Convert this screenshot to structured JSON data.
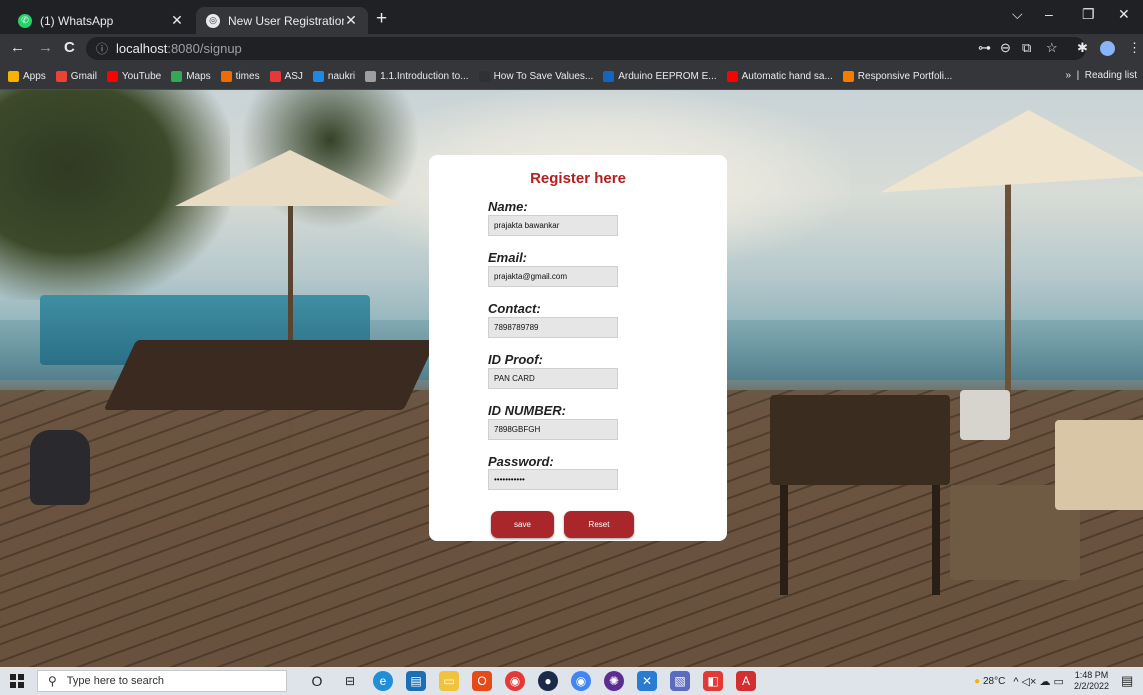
{
  "browser": {
    "tabs": [
      {
        "title": "(1) WhatsApp",
        "icon": "whatsapp-icon",
        "active": false
      },
      {
        "title": "New User Registration",
        "icon": "globe-icon",
        "active": true
      }
    ],
    "new_tab_symbol": "+",
    "window_controls": {
      "dropdown": "⌵",
      "minimize": "–",
      "maximize": "❐",
      "close": "✕"
    },
    "nav": {
      "back": "←",
      "forward": "→",
      "reload": "C"
    },
    "url_host": "localhost",
    "url_path": ":8080/signup",
    "toolbar_icons": {
      "key": "⊶",
      "zoom": "⊖",
      "share": "⧉",
      "star": "☆",
      "extensions": "✱",
      "menu": "⋮"
    },
    "bookmarks": [
      {
        "label": "Apps",
        "color": "#f4b400"
      },
      {
        "label": "Gmail",
        "color": "#ea4335"
      },
      {
        "label": "YouTube",
        "color": "#ff0000"
      },
      {
        "label": "Maps",
        "color": "#34a853"
      },
      {
        "label": "times",
        "color": "#ef6c00"
      },
      {
        "label": "ASJ",
        "color": "#e53935"
      },
      {
        "label": "naukri",
        "color": "#1e88e5"
      },
      {
        "label": "1.1.Introduction to...",
        "color": "#9e9e9e"
      },
      {
        "label": "How To Save Values...",
        "color": "#303134"
      },
      {
        "label": "Arduino EEPROM E...",
        "color": "#1565c0"
      },
      {
        "label": "Automatic hand sa...",
        "color": "#ff0000"
      },
      {
        "label": "Responsive Portfoli...",
        "color": "#f57c00"
      }
    ],
    "overflow": "»",
    "reading_list": "Reading list"
  },
  "form": {
    "title": "Register here",
    "fields": [
      {
        "label": "Name:",
        "value": "prajakta bawankar"
      },
      {
        "label": "Email:",
        "value": "prajakta@gmail.com"
      },
      {
        "label": "Contact:",
        "value": "7898789789"
      },
      {
        "label": "ID Proof:",
        "value": "PAN CARD"
      },
      {
        "label": "ID NUMBER:",
        "value": "7898GBFGH"
      },
      {
        "label": "Password:",
        "value": "•••••••••••"
      }
    ],
    "save_label": "save",
    "reset_label": "Reset",
    "accent": "#b21f1f",
    "button_color": "#a9262a"
  },
  "taskbar": {
    "search_placeholder": "Type here to search",
    "temperature": "28°C",
    "tray_icons": "^ ◁× ☁ ▭",
    "time": "1:48 PM",
    "date": "2/2/2022"
  }
}
